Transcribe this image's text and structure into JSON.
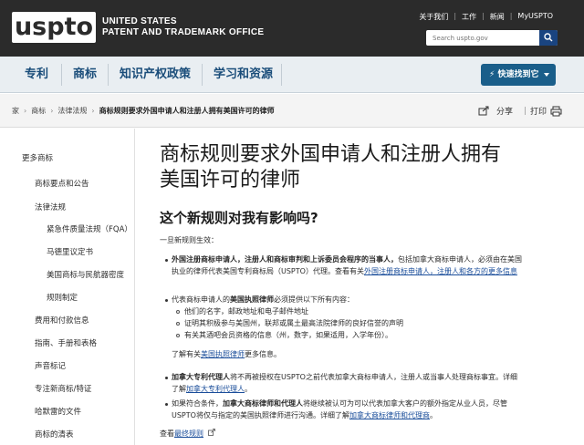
{
  "header": {
    "logo": "uspto",
    "org_line1": "UNITED STATES",
    "org_line2": "PATENT AND TRADEMARK OFFICE",
    "links": [
      "关于我们",
      "工作",
      "新闻",
      "MyUSPTO"
    ],
    "search_placeholder": "Search uspto.gov"
  },
  "nav": {
    "items": [
      "专利",
      "商标",
      "知识产权政策",
      "学习和资源"
    ],
    "quick_button": "快速找到它"
  },
  "breadcrumb": {
    "items": [
      "家",
      "商标",
      "法律法规"
    ],
    "current": "商标规则要求外国申请人和注册人拥有美国许可的律师",
    "share": "分享",
    "print": "打印"
  },
  "sidebar": {
    "items": [
      "更多商标",
      "商标要点和公告",
      "法律法规",
      "紧急件质量法规（FQA）",
      "马德里议定书",
      "美国商标与民航器密度",
      "规则制定",
      "费用和付款信息",
      "指南、手册和表格",
      "声音标记",
      "专注新商标/特证",
      "哈默雷的文件",
      "商标的清表"
    ]
  },
  "main": {
    "title_line1": "商标规则要求外国申请人和注册人拥有",
    "title_line2": "美国许可的律师",
    "subtitle": "这个新规则对我有影响吗?",
    "intro": "一旦新规则生效：",
    "b1_bold": "外国注册商标申请人，注册人和商标审判和上诉委员会程序的当事人，",
    "b1_text": "包括加拿大商标申请人，必须由在美国",
    "b1_line2": "执业的律师代表美国专利商标局（USPTO）代理。",
    "b1_line2b": "查看有关",
    "b1_link1": "外国注册商标申请人，注册人和",
    "b1_link2": "各方的更多信息",
    "b2_text1": "代表商标申请人的",
    "b2_bold": "美国执照律师",
    "b2_text2": "必须提供以下所有内容：",
    "sub1": "他们的名字，邮政地址和电子邮件地址",
    "sub2": "证明其积极参与美国州，联邦或属土最高法院律师的良好信誉的声明",
    "sub3": "有关其酒吧会员资格的信息（州，数字，如果适用，入学年份）。",
    "learn_more_pre": "了解有关",
    "learn_more_link": "美国执照律师",
    "learn_more_post": "更多信息。",
    "b3_bold": "加拿大专利代理人",
    "b3_text": "将不再被授权在USPTO之前代表加拿大商标申请人，注册人或当事人处理商标事宜。详细",
    "b3_line2_pre": "了解",
    "b3_link": "加拿大专利代理人",
    "b3_line2_post": "。",
    "b4_text1": "如果符合条件，",
    "b4_bold": "加拿大商标律师和代理人",
    "b4_text2": "将继续被认可为可以代表加拿大客户的额外指定从业人员，尽管",
    "b4_line2_pre": "USPTO将仅与指定的美国执照律师进行沟通。详细了解",
    "b4_link": "加拿大商标律师和代理商",
    "b4_line2_post": "。",
    "view_pre": "查看",
    "view_link": "最终规则"
  }
}
